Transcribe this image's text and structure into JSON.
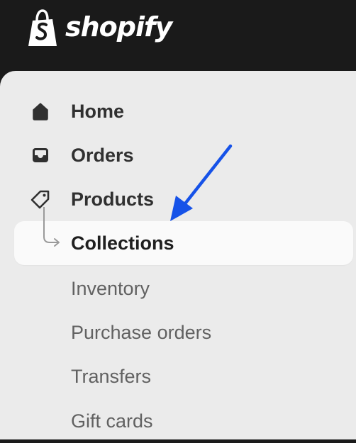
{
  "header": {
    "brand": "shopify",
    "logo_icon": "shopify-bag-icon"
  },
  "nav": {
    "items": [
      {
        "label": "Home",
        "icon": "home-icon"
      },
      {
        "label": "Orders",
        "icon": "inbox-icon"
      },
      {
        "label": "Products",
        "icon": "tag-icon"
      }
    ],
    "product_subitems": [
      {
        "label": "Collections",
        "active": true
      },
      {
        "label": "Inventory",
        "active": false
      },
      {
        "label": "Purchase orders",
        "active": false
      },
      {
        "label": "Transfers",
        "active": false
      },
      {
        "label": "Gift cards",
        "active": false
      }
    ]
  },
  "annotation": {
    "arrow_color": "#1652e8",
    "points_to": "Collections"
  },
  "colors": {
    "topbar": "#1a1a1a",
    "sidebar": "#ebebeb",
    "active_item_bg": "#fafafa",
    "primary_text": "#303030",
    "secondary_text": "#616161"
  }
}
